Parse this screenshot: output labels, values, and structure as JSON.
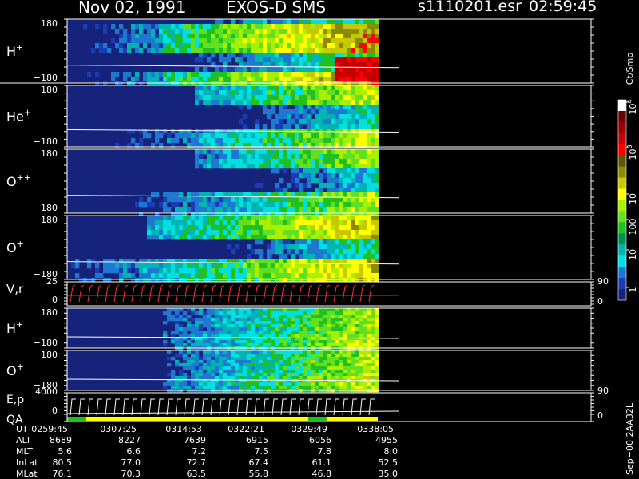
{
  "header": {
    "date": "Nov 02, 1991",
    "instrument": "EXOS-D SMS",
    "file": "s1110201.esr",
    "time": "02:59:45"
  },
  "chart_data": {
    "type": "heatmap",
    "panels": [
      {
        "label": "H",
        "sup": "+",
        "ytop": "180",
        "ybot": "−180"
      },
      {
        "label": "He",
        "sup": "+",
        "ytop": "180",
        "ybot": "−180"
      },
      {
        "label": "O",
        "sup": "++",
        "ytop": "180",
        "ybot": "−180"
      },
      {
        "label": "O",
        "sup": "+",
        "ytop": "180",
        "ybot": "−180"
      },
      {
        "label": "V,r",
        "sup": "",
        "ytop": "25",
        "ybot": "0",
        "rtop": "90",
        "rbot": "0"
      },
      {
        "label": "H",
        "sup": "+",
        "ytop": "180",
        "ybot": "−180"
      },
      {
        "label": "O",
        "sup": "+",
        "ytop": "180",
        "ybot": "−180"
      },
      {
        "label": "E,p",
        "sup": "",
        "label2": "QA",
        "ytop": "4000",
        "ybot": "0",
        "rtop": "90",
        "rbot": "0"
      }
    ],
    "colorbar": {
      "unit": "Ct/Smp",
      "ticks": [
        "10",
        "10",
        "10",
        "100",
        "10",
        "1"
      ],
      "tick_sups": [
        "4",
        "3",
        "",
        "",
        "",
        ""
      ],
      "colors": [
        "#ffffff",
        "#6a0000",
        "#9a0000",
        "#c40000",
        "#ff0000",
        "#5a5a00",
        "#8a8a00",
        "#c8c800",
        "#ffff00",
        "#a8f000",
        "#60e020",
        "#20c020",
        "#009050",
        "#00b4b4",
        "#00e0e0",
        "#1c78d0",
        "#1a3cb4",
        "#16237a"
      ]
    },
    "x_axis": {
      "rows": [
        {
          "name": "UT",
          "values": [
            "0259:45",
            "0307:25",
            "0314:53",
            "0322:21",
            "0329:49",
            "0338:05"
          ]
        },
        {
          "name": "ALT",
          "values": [
            "8689",
            "8227",
            "7639",
            "6915",
            "6056",
            "4955"
          ]
        },
        {
          "name": "MLT",
          "values": [
            "5.6",
            "6.6",
            "7.2",
            "7.5",
            "7.8",
            "8.0"
          ]
        },
        {
          "name": "InLat",
          "values": [
            "80.5",
            "77.0",
            "72.7",
            "67.4",
            "61.1",
            "52.5"
          ]
        },
        {
          "name": "MLat",
          "values": [
            "76.1",
            "70.3",
            "63.5",
            "55.8",
            "46.8",
            "35.0"
          ]
        }
      ]
    },
    "side_label": "Sep−00 2AA32L"
  }
}
